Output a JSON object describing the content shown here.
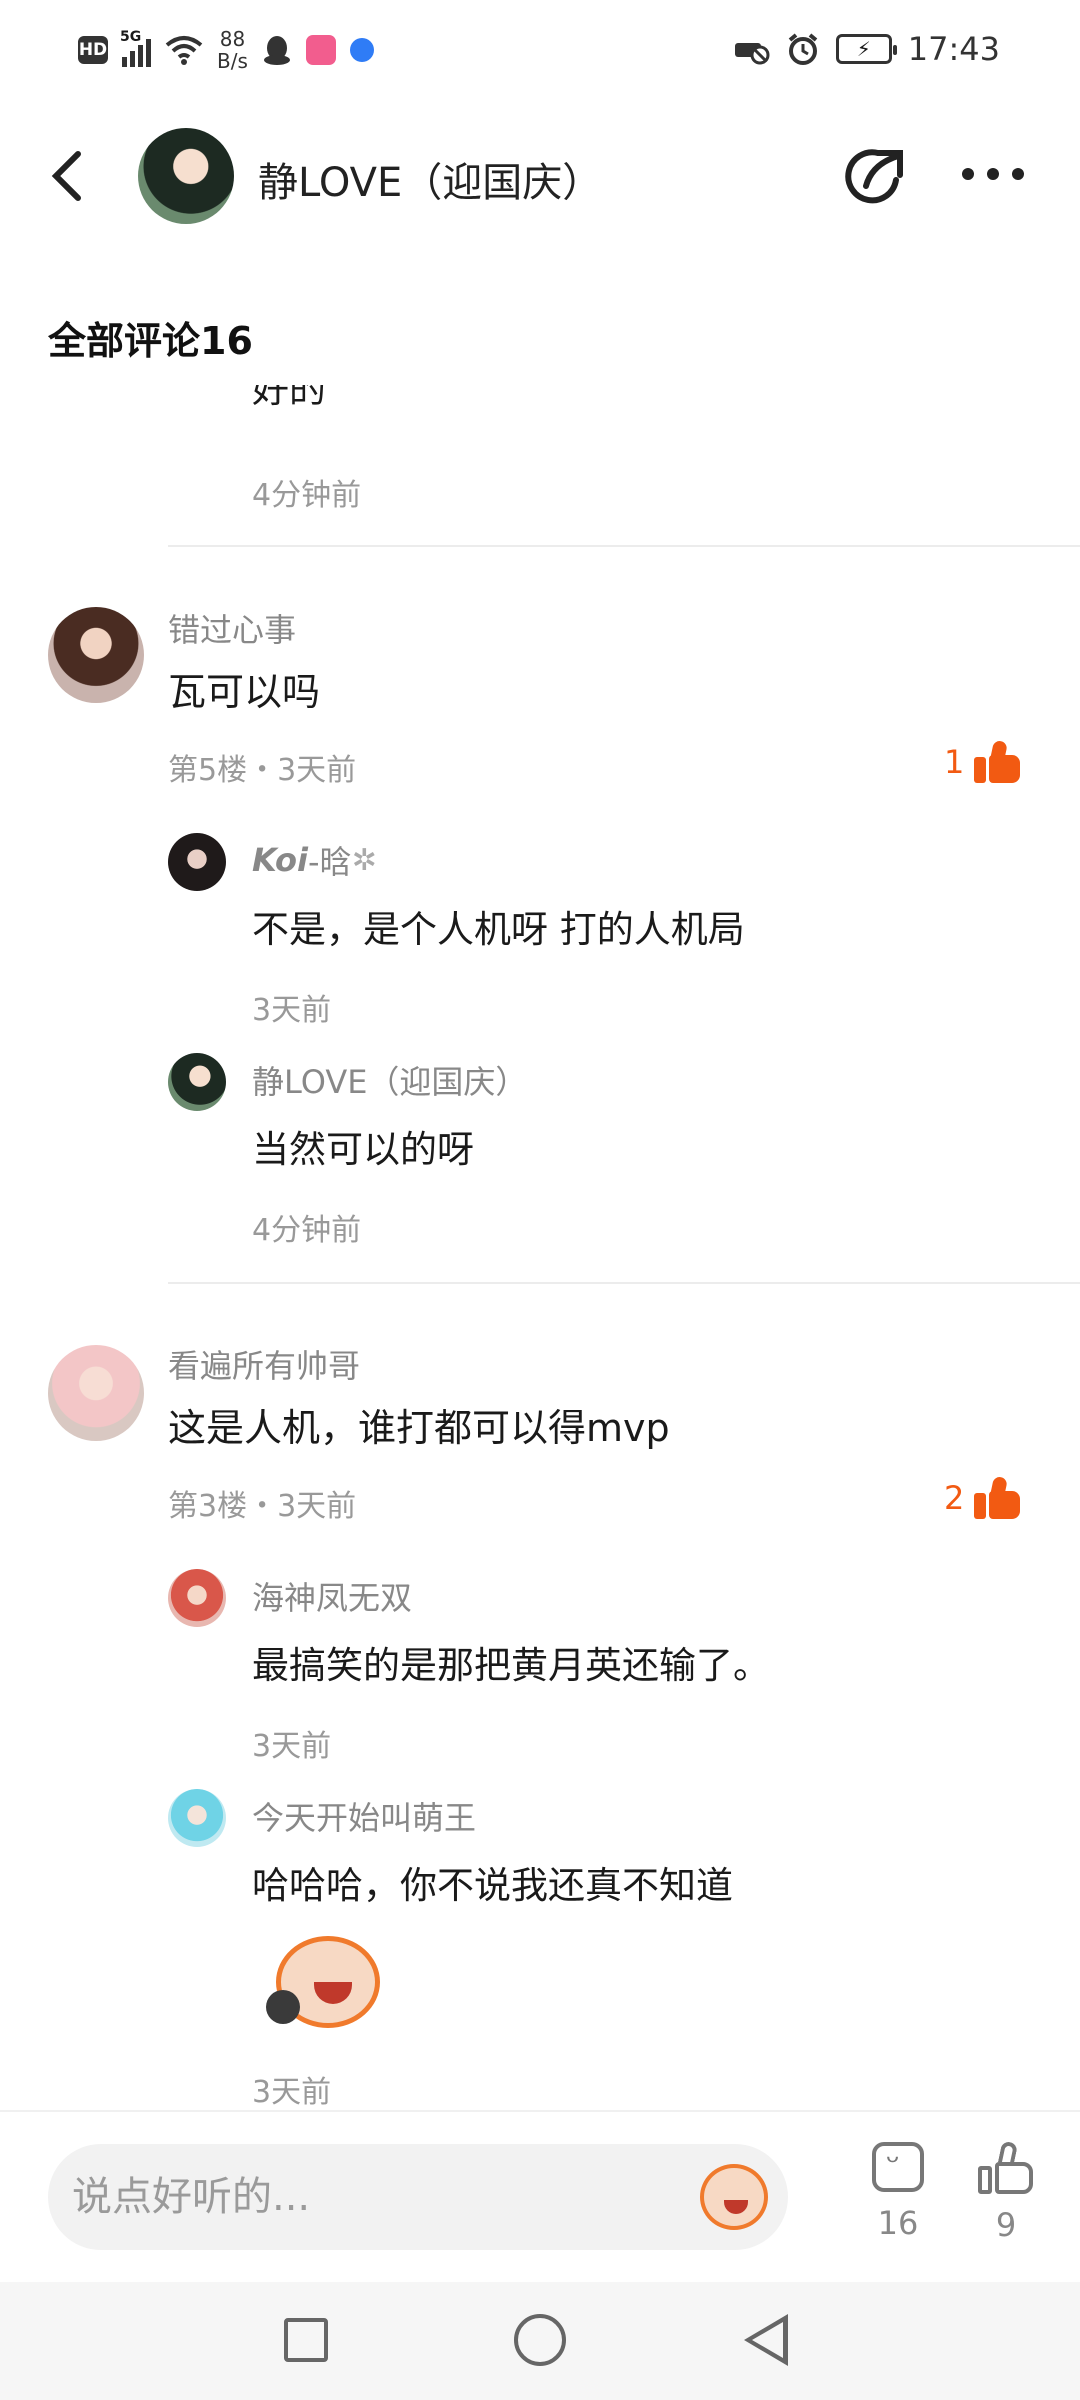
{
  "status_bar": {
    "hd": "HD",
    "network": "5G",
    "speed_value": "88",
    "speed_unit": "B/s",
    "time": "17:43"
  },
  "header": {
    "title": "静LOVE（迎国庆）"
  },
  "section": {
    "title": "全部评论16"
  },
  "comments": {
    "partial": {
      "text": "好的",
      "time": "4分钟前"
    },
    "c1": {
      "user": "错过心事",
      "text": "瓦可以吗",
      "meta": "第5楼・3天前",
      "likes": "1",
      "replies": [
        {
          "user": "Koi",
          "user_suffix": "-晗",
          "text": "不是，是个人机呀 打的人机局",
          "time": "3天前"
        },
        {
          "user": "静LOVE（迎国庆）",
          "text": "当然可以的呀",
          "time": "4分钟前"
        }
      ]
    },
    "c2": {
      "user": "看遍所有帅哥",
      "text": "这是人机，谁打都可以得mvp",
      "meta": "第3楼・3天前",
      "likes": "2",
      "replies": [
        {
          "user": "海神凤无双",
          "text": "最搞笑的是那把黄月英还输了。",
          "time": "3天前"
        },
        {
          "user": "今天开始叫萌王",
          "text": "哈哈哈，你不说我还真不知道",
          "time": "3天前"
        }
      ]
    }
  },
  "input_bar": {
    "placeholder": "说点好听的...",
    "comment_count": "16",
    "like_count": "9"
  },
  "colors": {
    "accent": "#f25a12",
    "meta_gray": "#999999"
  }
}
